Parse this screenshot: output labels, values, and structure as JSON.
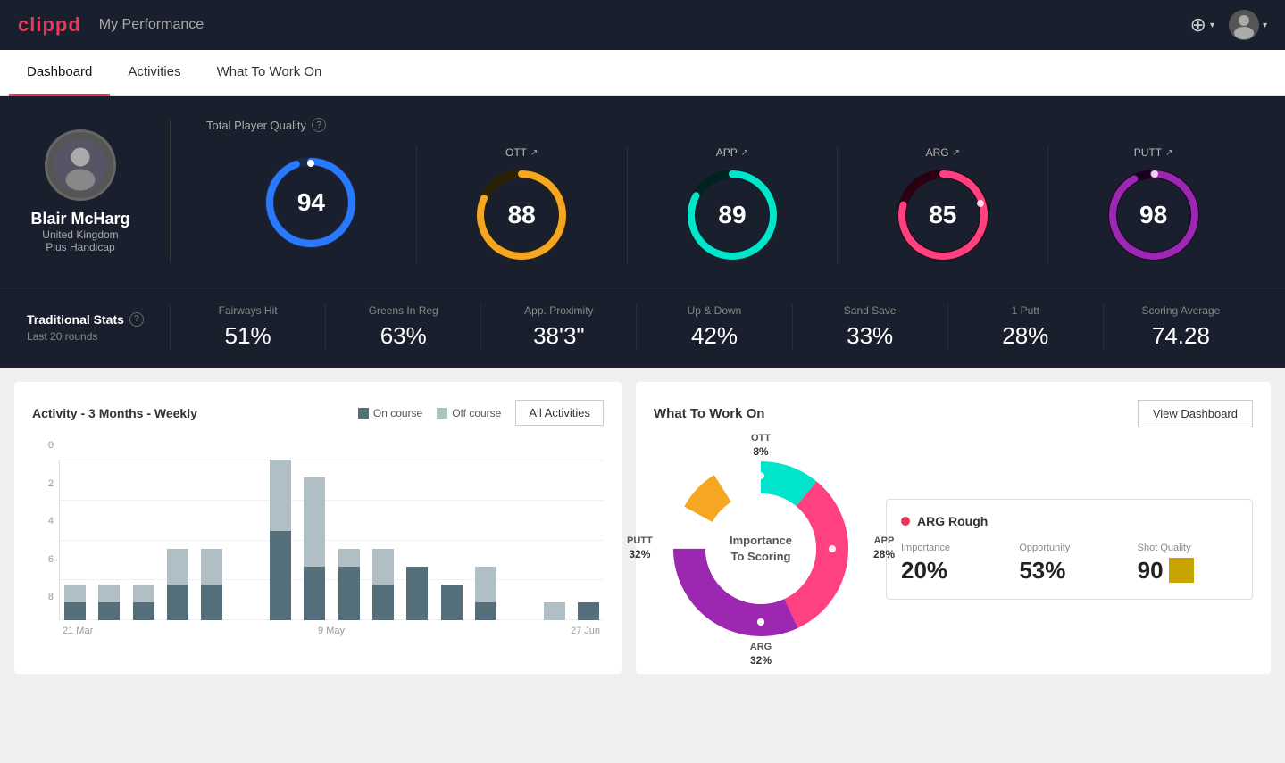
{
  "header": {
    "logo": "clippd",
    "title": "My Performance",
    "add_icon": "⊕",
    "avatar_chevron": "▾"
  },
  "nav": {
    "tabs": [
      "Dashboard",
      "Activities",
      "What To Work On"
    ],
    "active": "Dashboard"
  },
  "hero": {
    "player": {
      "name": "Blair McHarg",
      "country": "United Kingdom",
      "handicap": "Plus Handicap"
    },
    "total_quality_label": "Total Player Quality",
    "gauges": [
      {
        "id": "tpq",
        "label": "",
        "value": 94,
        "color": "#2979ff",
        "bg": "#1a2a4a",
        "pct": 94
      },
      {
        "id": "ott",
        "label": "OTT",
        "value": 88,
        "color": "#f5a623",
        "bg": "#2a2200",
        "pct": 88
      },
      {
        "id": "app",
        "label": "APP",
        "value": 89,
        "color": "#00e5cc",
        "bg": "#00231f",
        "pct": 89
      },
      {
        "id": "arg",
        "label": "ARG",
        "value": 85,
        "color": "#ff4081",
        "bg": "#2a0010",
        "pct": 85
      },
      {
        "id": "putt",
        "label": "PUTT",
        "value": 98,
        "color": "#9c27b0",
        "bg": "#1a0020",
        "pct": 98
      }
    ]
  },
  "trad_stats": {
    "label": "Traditional Stats",
    "sub": "Last 20 rounds",
    "items": [
      {
        "name": "Fairways Hit",
        "value": "51%"
      },
      {
        "name": "Greens In Reg",
        "value": "63%"
      },
      {
        "name": "App. Proximity",
        "value": "38'3\""
      },
      {
        "name": "Up & Down",
        "value": "42%"
      },
      {
        "name": "Sand Save",
        "value": "33%"
      },
      {
        "name": "1 Putt",
        "value": "28%"
      },
      {
        "name": "Scoring Average",
        "value": "74.28"
      }
    ]
  },
  "activity_chart": {
    "title": "Activity - 3 Months - Weekly",
    "legend": {
      "on_course": "On course",
      "off_course": "Off course"
    },
    "button": "All Activities",
    "y_labels": [
      "0",
      "2",
      "4",
      "6",
      "8"
    ],
    "x_labels": [
      "21 Mar",
      "",
      "9 May",
      "",
      "27 Jun"
    ],
    "bars": [
      {
        "on": 1,
        "off": 1
      },
      {
        "on": 1,
        "off": 1
      },
      {
        "on": 1,
        "off": 1
      },
      {
        "on": 2,
        "off": 2
      },
      {
        "on": 2,
        "off": 2
      },
      {
        "on": 0,
        "off": 0
      },
      {
        "on": 5,
        "off": 4
      },
      {
        "on": 3,
        "off": 5
      },
      {
        "on": 3,
        "off": 1
      },
      {
        "on": 2,
        "off": 2
      },
      {
        "on": 3,
        "off": 0
      },
      {
        "on": 2,
        "off": 0
      },
      {
        "on": 1,
        "off": 2
      },
      {
        "on": 0,
        "off": 0
      },
      {
        "on": 0,
        "off": 1
      },
      {
        "on": 1,
        "off": 0
      }
    ]
  },
  "work_on": {
    "title": "What To Work On",
    "button": "View Dashboard",
    "donut_center": "Importance\nTo Scoring",
    "segments": [
      {
        "label": "OTT",
        "value": "8%",
        "color": "#f5a623",
        "pct": 8
      },
      {
        "label": "APP",
        "value": "28%",
        "color": "#00e5cc",
        "pct": 28
      },
      {
        "label": "ARG",
        "value": "32%",
        "color": "#ff4081",
        "pct": 32
      },
      {
        "label": "PUTT",
        "value": "32%",
        "color": "#9c27b0",
        "pct": 32
      }
    ],
    "highlight_card": {
      "title": "ARG Rough",
      "dot_color": "#e8365d",
      "importance_label": "Importance",
      "importance_value": "20%",
      "opportunity_label": "Opportunity",
      "opportunity_value": "53%",
      "quality_label": "Shot Quality",
      "quality_value": "90"
    }
  }
}
